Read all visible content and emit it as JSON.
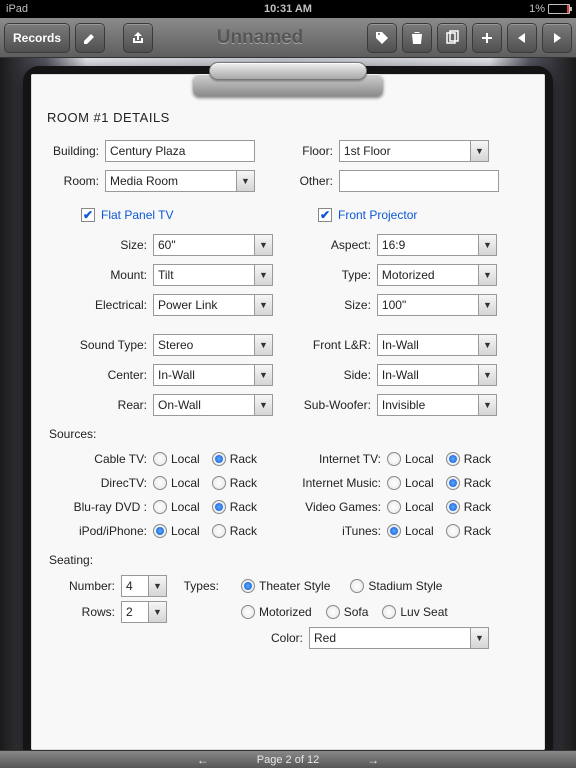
{
  "status": {
    "device": "iPad",
    "time": "10:31 AM",
    "battery_pct": "1%"
  },
  "toolbar": {
    "records": "Records",
    "title": "Unnamed"
  },
  "form": {
    "title": "ROOM #1 DETAILS",
    "building": {
      "label": "Building:",
      "value": "Century Plaza"
    },
    "floor": {
      "label": "Floor:",
      "value": "1st Floor"
    },
    "room": {
      "label": "Room:",
      "value": "Media Room"
    },
    "other": {
      "label": "Other:",
      "value": ""
    },
    "flat_panel": {
      "label": "Flat Panel TV",
      "checked": true,
      "size": {
        "label": "Size:",
        "value": "60\""
      },
      "mount": {
        "label": "Mount:",
        "value": "Tilt"
      },
      "elec": {
        "label": "Electrical:",
        "value": "Power Link"
      }
    },
    "projector": {
      "label": "Front Projector",
      "checked": true,
      "aspect": {
        "label": "Aspect:",
        "value": "16:9"
      },
      "type": {
        "label": "Type:",
        "value": "Motorized"
      },
      "size": {
        "label": "Size:",
        "value": "100\""
      }
    },
    "sound": {
      "sound_type": {
        "label": "Sound Type:",
        "value": "Stereo"
      },
      "center": {
        "label": "Center:",
        "value": "In-Wall"
      },
      "rear": {
        "label": "Rear:",
        "value": "On-Wall"
      },
      "front_lr": {
        "label": "Front L&R:",
        "value": "In-Wall"
      },
      "side": {
        "label": "Side:",
        "value": "In-Wall"
      },
      "sub": {
        "label": "Sub-Woofer:",
        "value": "Invisible"
      }
    },
    "sources_label": "Sources:",
    "opt_local": "Local",
    "opt_rack": "Rack",
    "sources_left": [
      {
        "label": "Cable TV:",
        "value": "Rack"
      },
      {
        "label": "DirecTV:",
        "value": ""
      },
      {
        "label": "Blu-ray DVD :",
        "value": "Rack"
      },
      {
        "label": "iPod/iPhone:",
        "value": "Local"
      }
    ],
    "sources_right": [
      {
        "label": "Internet TV:",
        "value": "Rack"
      },
      {
        "label": "Internet Music:",
        "value": "Rack"
      },
      {
        "label": "Video Games:",
        "value": "Rack"
      },
      {
        "label": "iTunes:",
        "value": "Local"
      }
    ],
    "seating_label": "Seating:",
    "seating": {
      "number": {
        "label": "Number:",
        "value": "4"
      },
      "rows": {
        "label": "Rows:",
        "value": "2"
      },
      "types_label": "Types:",
      "type_opts": [
        "Theater Style",
        "Stadium Style"
      ],
      "type_value": "Theater Style",
      "feat_opts": [
        "Motorized",
        "Sofa",
        "Luv Seat"
      ],
      "feat_value": "",
      "color": {
        "label": "Color:",
        "value": "Red"
      }
    }
  },
  "pager": {
    "text": "Page 2 of 12"
  }
}
